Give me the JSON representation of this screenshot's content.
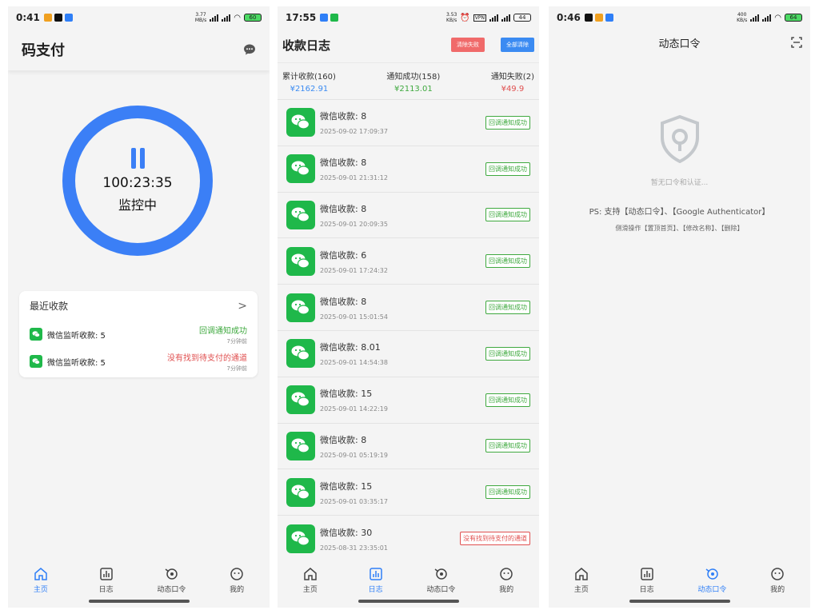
{
  "screen1": {
    "status": {
      "time": "0:41",
      "net": "3.77\nMB/s",
      "battery": "60"
    },
    "title": "码支付",
    "timer": "100:23:35",
    "monitoring": "监控中",
    "recent": {
      "title": "最近收款",
      "chevron": ">",
      "items": [
        {
          "text": "微信监听收款: 5",
          "status": "回调通知成功",
          "status_type": "ok",
          "ago": "7分钟前"
        },
        {
          "text": "微信监听收款: 5",
          "status": "没有找到待支付的通道",
          "status_type": "fail",
          "ago": "7分钟前"
        }
      ]
    }
  },
  "screen2": {
    "status": {
      "time": "17:55",
      "net": "3.53\nKB/s",
      "battery": "44"
    },
    "title": "收款日志",
    "clear_fail": "清除失败",
    "clear_all": "全部清除",
    "stats": [
      {
        "label": "累计收款(160)",
        "value": "¥2162.91",
        "color": "blue"
      },
      {
        "label": "通知成功(158)",
        "value": "¥2113.01",
        "color": "ok"
      },
      {
        "label": "通知失败(2)",
        "value": "¥49.9",
        "color": "fail"
      }
    ],
    "logs": [
      {
        "amount": "微信收款: 8",
        "date": "2025-09-02 17:09:37",
        "status": "回调通知成功",
        "type": "ok"
      },
      {
        "amount": "微信收款: 8",
        "date": "2025-09-01 21:31:12",
        "status": "回调通知成功",
        "type": "ok"
      },
      {
        "amount": "微信收款: 8",
        "date": "2025-09-01 20:09:35",
        "status": "回调通知成功",
        "type": "ok"
      },
      {
        "amount": "微信收款: 6",
        "date": "2025-09-01 17:24:32",
        "status": "回调通知成功",
        "type": "ok"
      },
      {
        "amount": "微信收款: 8",
        "date": "2025-09-01 15:01:54",
        "status": "回调通知成功",
        "type": "ok"
      },
      {
        "amount": "微信收款: 8.01",
        "date": "2025-09-01 14:54:38",
        "status": "回调通知成功",
        "type": "ok"
      },
      {
        "amount": "微信收款: 15",
        "date": "2025-09-01 14:22:19",
        "status": "回调通知成功",
        "type": "ok"
      },
      {
        "amount": "微信收款: 8",
        "date": "2025-09-01 05:19:19",
        "status": "回调通知成功",
        "type": "ok"
      },
      {
        "amount": "微信收款: 15",
        "date": "2025-09-01 03:35:17",
        "status": "回调通知成功",
        "type": "ok"
      },
      {
        "amount": "微信收款: 30",
        "date": "2025-08-31 23:35:01",
        "status": "没有找到待支付的通道",
        "type": "fail"
      }
    ]
  },
  "screen3": {
    "status": {
      "time": "0:46",
      "net": "400\nKB/s",
      "battery": "64"
    },
    "title": "动态口令",
    "empty": "暂无口令和认证...",
    "ps": "PS: 支持【动态口令】、【Google Authenticator】",
    "ps2": "侧滑操作【置顶首页】、【修改名称】、【删除】"
  },
  "tabs": [
    "主页",
    "日志",
    "动态口令",
    "我的"
  ],
  "active_tabs": [
    0,
    1,
    2
  ],
  "colors": {
    "accent": "#3b7ff6",
    "success": "#3fa93f",
    "error": "#e05050",
    "wechat": "#1fb84a"
  }
}
